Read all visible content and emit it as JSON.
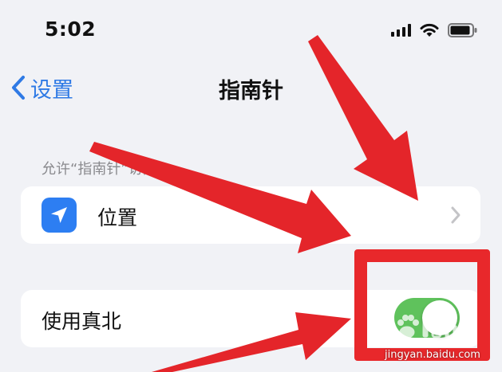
{
  "status_bar": {
    "time": "5:02"
  },
  "nav": {
    "back_label": "设置",
    "title": "指南针"
  },
  "section": {
    "header": "允许“指南针”访问"
  },
  "rows": {
    "location": {
      "label": "位置"
    },
    "true_north": {
      "label": "使用真北",
      "toggle_on": true
    }
  },
  "watermark": {
    "url": "jingyan.baidu.com"
  },
  "colors": {
    "accent": "#2f7ae5",
    "toggle_on": "#5fc25c",
    "annotation": "#e8282b",
    "location_icon_bg": "#2d7ef2"
  },
  "icons": {
    "back": "chevron-left-icon",
    "location": "location-arrow-icon",
    "disclosure": "chevron-right-icon",
    "signal": "cellular-signal-icon",
    "wifi": "wifi-icon",
    "battery": "battery-icon"
  }
}
